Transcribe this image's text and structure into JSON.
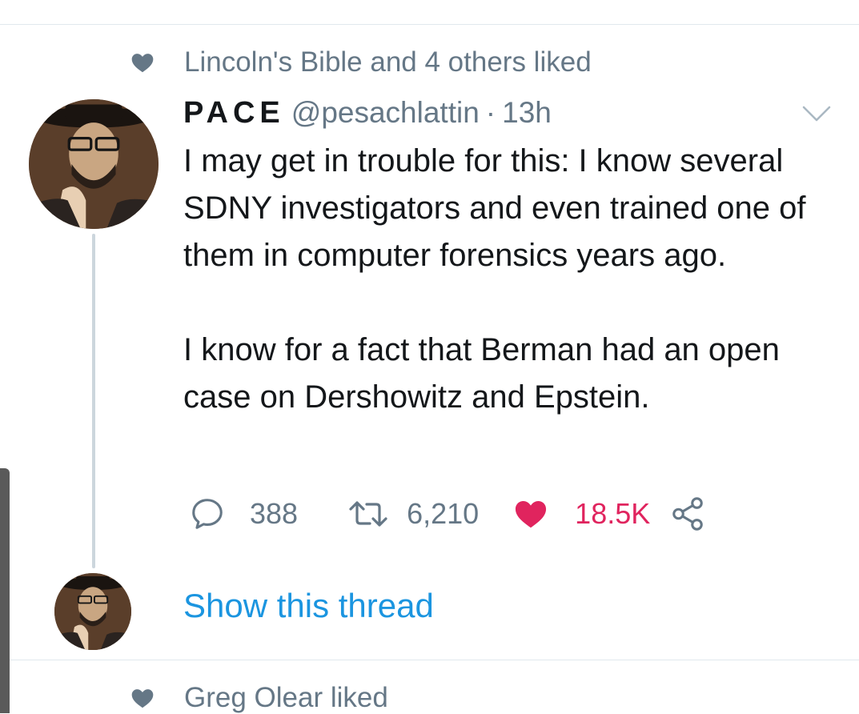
{
  "social_context_top": {
    "icon": "heart-icon",
    "text": "Lincoln's Bible and 4 others liked"
  },
  "tweet": {
    "display_name": "PACE",
    "handle": "@pesachlattin",
    "separator": "·",
    "time": "13h",
    "paragraph_1": "I may get in trouble for this:  I know several SDNY investigators and even trained one of them in computer forensics years ago.",
    "paragraph_2": "I know for a fact that Berman had an open case on Dershowitz and Epstein.",
    "actions": {
      "reply_count": "388",
      "retweet_count": "6,210",
      "like_count": "18.5K",
      "liked": true
    }
  },
  "show_thread_label": "Show this thread",
  "social_context_bottom": {
    "icon": "heart-icon",
    "text": "Greg Olear liked"
  },
  "colors": {
    "muted": "#657786",
    "text": "#14171a",
    "link": "#1b95e0",
    "like": "#e0245e",
    "divider": "#e1e8ed"
  }
}
